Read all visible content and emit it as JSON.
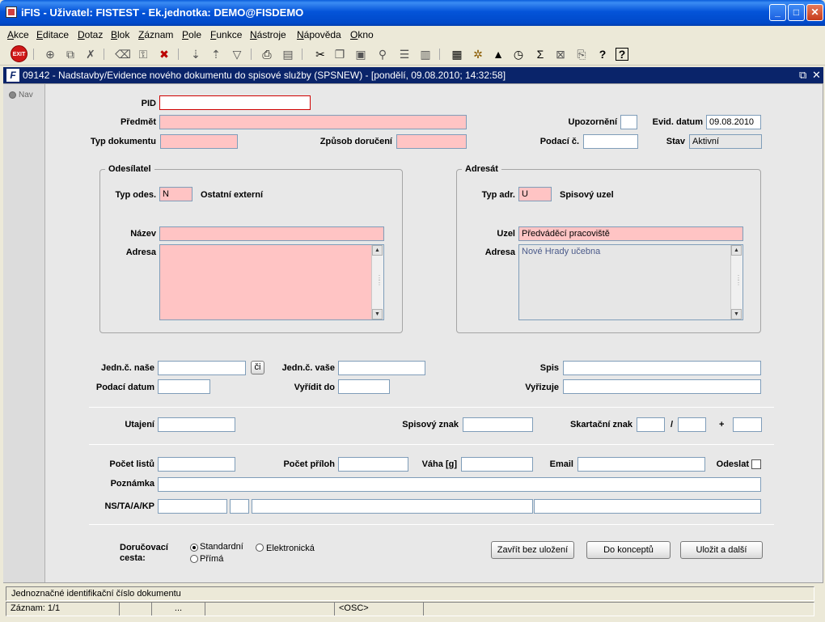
{
  "window": {
    "title": "iFIS - Uživatel: FISTEST - Ek.jednotka: DEMO@FISDEMO"
  },
  "menu": [
    "Akce",
    "Editace",
    "Dotaz",
    "Blok",
    "Záznam",
    "Pole",
    "Funkce",
    "Nástroje",
    "Nápověda",
    "Okno"
  ],
  "toolbar": {
    "exit_label": "EXIT",
    "icons": [
      "insert-record-icon",
      "duplicate-record-icon",
      "delete-record-icon",
      "clear-form-icon",
      "lock-icon",
      "delete-icon",
      "sort-asc-icon",
      "sort-desc-icon",
      "filter-icon",
      "print-icon",
      "print-preview-icon",
      "cut-icon",
      "copy-icon",
      "paste-icon",
      "find-icon",
      "list-icon",
      "columns-icon",
      "calculator-icon",
      "settings-icon",
      "chart-icon",
      "clock-icon",
      "sum-icon",
      "export-icon",
      "attach-icon",
      "help-icon",
      "whats-this-icon"
    ]
  },
  "form": {
    "title": "09142 - Nadstavby/Evidence nového dokumentu do spisové služby (SPSNEW) - [pondělí, 09.08.2010; 14:32:58]",
    "nav_label": "Nav",
    "fields": {
      "pid": {
        "label": "PID",
        "value": ""
      },
      "predmet": {
        "label": "Předmět",
        "value": ""
      },
      "typ_dokumentu": {
        "label": "Typ dokumentu",
        "value": ""
      },
      "zpusob_doruceni": {
        "label": "Způsob doručení",
        "value": ""
      },
      "upozorneni": {
        "label": "Upozornění",
        "value": ""
      },
      "evid_datum": {
        "label": "Evid. datum",
        "value": "09.08.2010"
      },
      "podaci_c": {
        "label": "Podací č.",
        "value": ""
      },
      "stav": {
        "label": "Stav",
        "value": "Aktivní"
      }
    },
    "odesilatel": {
      "title": "Odesílatel",
      "typ_label": "Typ odes.",
      "typ_value": "N",
      "typ_desc": "Ostatní externí",
      "nazev_label": "Název",
      "nazev_value": "",
      "adresa_label": "Adresa",
      "adresa_value": ""
    },
    "adresat": {
      "title": "Adresát",
      "typ_label": "Typ adr.",
      "typ_value": "U",
      "typ_desc": "Spisový uzel",
      "uzel_label": "Uzel",
      "uzel_value": "Předváděcí pracoviště",
      "adresa_label": "Adresa",
      "adresa_value": "Nové Hrady učebna"
    },
    "lower": {
      "jedn_nase": "Jedn.č. naše",
      "ci_button": "či",
      "jedn_vase": "Jedn.č. vaše",
      "spis": "Spis",
      "podaci_datum": "Podací datum",
      "vyridit_do": "Vyřídit do",
      "vyrizuje": "Vyřizuje",
      "utajeni": "Utajení",
      "spisovy_znak": "Spisový znak",
      "skartacni_znak": "Skartační znak",
      "slash": "/",
      "plus": "+",
      "pocet_listu": "Počet listů",
      "pocet_priloh": "Počet příloh",
      "vaha": "Váha [g]",
      "email": "Email",
      "odeslat": "Odeslat",
      "poznamka": "Poznámka",
      "ns_ta": "NS/TA/A/KP"
    },
    "delivery": {
      "label_line1": "Doručovací",
      "label_line2": "cesta:",
      "standard": "Standardní",
      "elektronicka": "Elektronická",
      "prima": "Přímá",
      "selected": "Standardní"
    },
    "buttons": {
      "zavrit": "Zavřít bez uložení",
      "koncept": "Do konceptů",
      "ulozit": "Uložit a další"
    }
  },
  "status": {
    "hint": "Jednoznačné identifikační číslo dokumentu",
    "record": "Záznam: 1/1",
    "dots": "...",
    "osc": "<OSC>"
  }
}
